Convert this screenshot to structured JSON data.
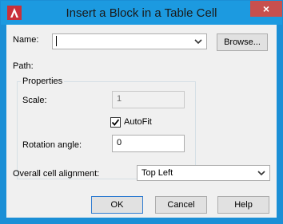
{
  "window": {
    "title": "Insert a Block in a Table Cell",
    "close_glyph": "×"
  },
  "name_field": {
    "label": "Name:",
    "value": ""
  },
  "browse_button": "Browse...",
  "path_label": "Path:",
  "properties": {
    "title": "Properties",
    "scale_label": "Scale:",
    "scale_value": "1",
    "autofit_label": "AutoFit",
    "autofit_checked": true,
    "rotation_label": "Rotation angle:",
    "rotation_value": "0"
  },
  "alignment": {
    "label": "Overall cell alignment:",
    "value": "Top Left"
  },
  "buttons": {
    "ok": "OK",
    "cancel": "Cancel",
    "help": "Help"
  },
  "colors": {
    "titlebar": "#1c9ae0",
    "close": "#c7504e",
    "client": "#f0f0f0"
  },
  "icons": {
    "app": "autocad-icon",
    "close": "close-icon",
    "dropdown": "chevron-down-icon",
    "check": "checkmark-icon"
  }
}
